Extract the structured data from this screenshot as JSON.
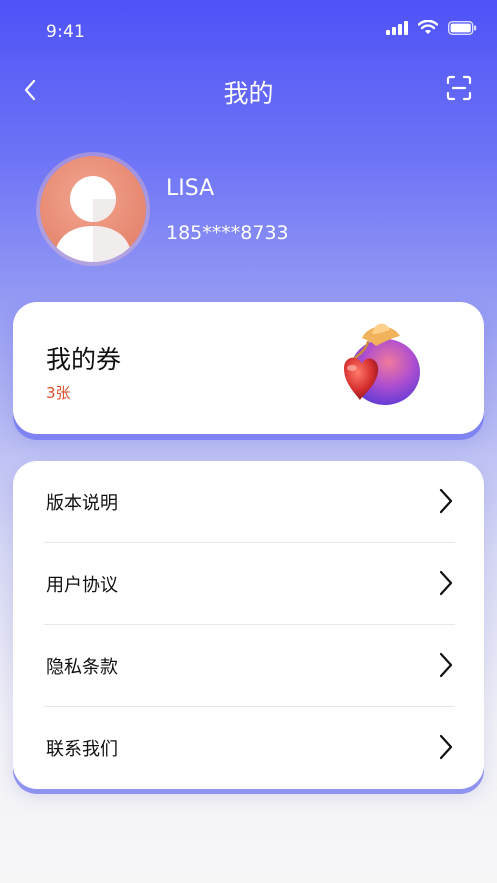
{
  "status_bar": {
    "time": "9:41"
  },
  "nav": {
    "title": "我的",
    "back_icon": "back-chevron-icon",
    "scan_icon": "scan-icon"
  },
  "profile": {
    "name": "LISA",
    "phone": "185****8733"
  },
  "coupon": {
    "title": "我的券",
    "count": "3张"
  },
  "menu": {
    "items": [
      {
        "label": "版本说明"
      },
      {
        "label": "用户协议"
      },
      {
        "label": "隐私条款"
      },
      {
        "label": "联系我们"
      }
    ]
  },
  "colors": {
    "accent": "#4f52f7",
    "count_red": "#e0502c"
  }
}
